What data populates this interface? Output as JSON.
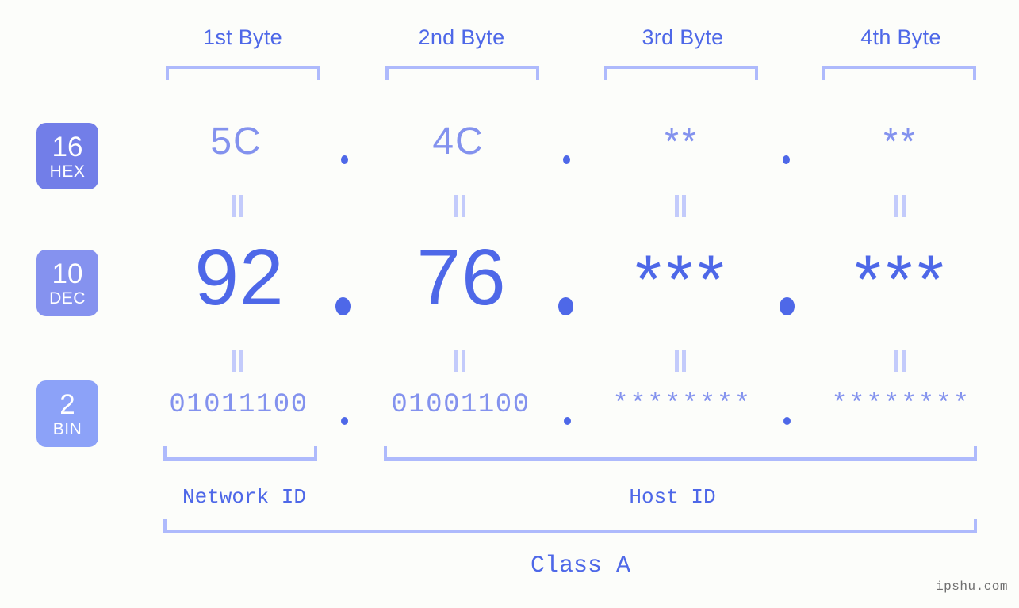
{
  "title": "IP address byte breakdown",
  "background_color": "#fcfdfa",
  "accent_color": "#4e68e8",
  "light_accent_color": "#8392ee",
  "bracket_color": "#aebafc",
  "columns": [
    {
      "label": "1st Byte"
    },
    {
      "label": "2nd Byte"
    },
    {
      "label": "3rd Byte"
    },
    {
      "label": "4th Byte"
    }
  ],
  "rows": {
    "hex": {
      "badge_number": "16",
      "badge_name": "HEX",
      "badge_color": "#727ee8",
      "values": [
        "5C",
        "4C",
        "**",
        "**"
      ],
      "separator": "."
    },
    "dec": {
      "badge_number": "10",
      "badge_name": "DEC",
      "badge_color": "#8592ef",
      "values": [
        "92",
        "76",
        "***",
        "***"
      ],
      "separator": "."
    },
    "bin": {
      "badge_number": "2",
      "badge_name": "BIN",
      "badge_color": "#8ca2f8",
      "values": [
        "01011100",
        "01001100",
        "********",
        "********"
      ],
      "separator": "."
    }
  },
  "segments": {
    "network_id": "Network ID",
    "host_id": "Host ID",
    "class": "Class A"
  },
  "watermark": "ipshu.com"
}
